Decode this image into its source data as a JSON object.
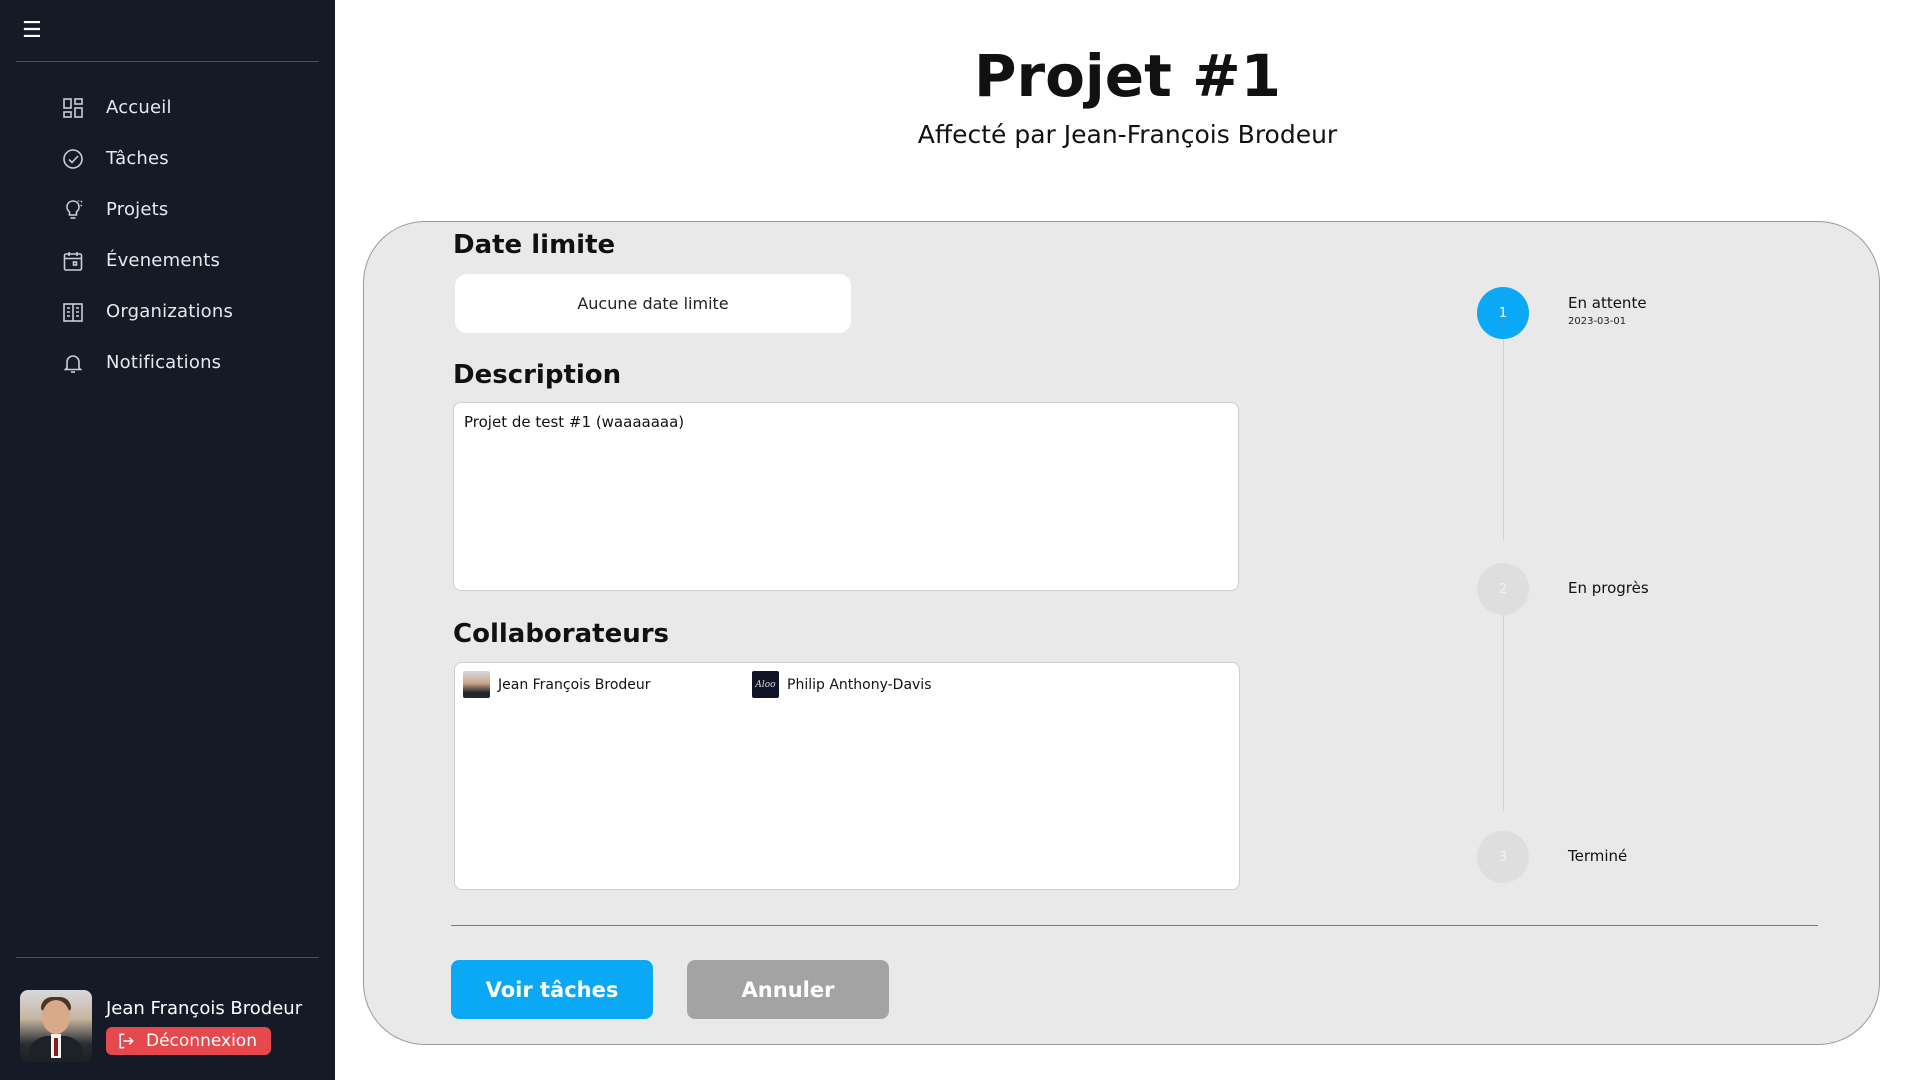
{
  "sidebar": {
    "menu_icon": "☰",
    "items": [
      {
        "label": "Accueil",
        "icon": "dashboard-icon"
      },
      {
        "label": "Tâches",
        "icon": "check-circle-icon"
      },
      {
        "label": "Projets",
        "icon": "lightbulb-icon"
      },
      {
        "label": "Évenements",
        "icon": "calendar-icon"
      },
      {
        "label": "Organizations",
        "icon": "building-icon"
      },
      {
        "label": "Notifications",
        "icon": "bell-icon"
      }
    ],
    "user": {
      "name": "Jean François Brodeur",
      "logout_label": "Déconnexion"
    }
  },
  "header": {
    "title": "Projet #1",
    "subtitle": "Affecté par Jean-François Brodeur"
  },
  "form": {
    "deadline_label": "Date limite",
    "deadline_value": "Aucune date limite",
    "description_label": "Description",
    "description_value": "Projet de test #1 (waaaaaaa)",
    "collaborators_label": "Collaborateurs",
    "collaborators": [
      {
        "name": "Jean François Brodeur",
        "avatar": "photo"
      },
      {
        "name": "Philip Anthony-Davis",
        "avatar_text": "Aloo"
      }
    ]
  },
  "actions": {
    "primary_label": "Voir tâches",
    "secondary_label": "Annuler"
  },
  "status_steps": [
    {
      "number": "1",
      "title": "En attente",
      "date": "2023-03-01",
      "state": "active"
    },
    {
      "number": "2",
      "title": "En progrès",
      "date": "",
      "state": "inactive"
    },
    {
      "number": "3",
      "title": "Terminé",
      "date": "",
      "state": "inactive"
    }
  ],
  "colors": {
    "sidebar_bg": "#141b27",
    "accent": "#0aa8f5",
    "logout": "#e5484d",
    "card_bg": "#e9e9e9"
  }
}
